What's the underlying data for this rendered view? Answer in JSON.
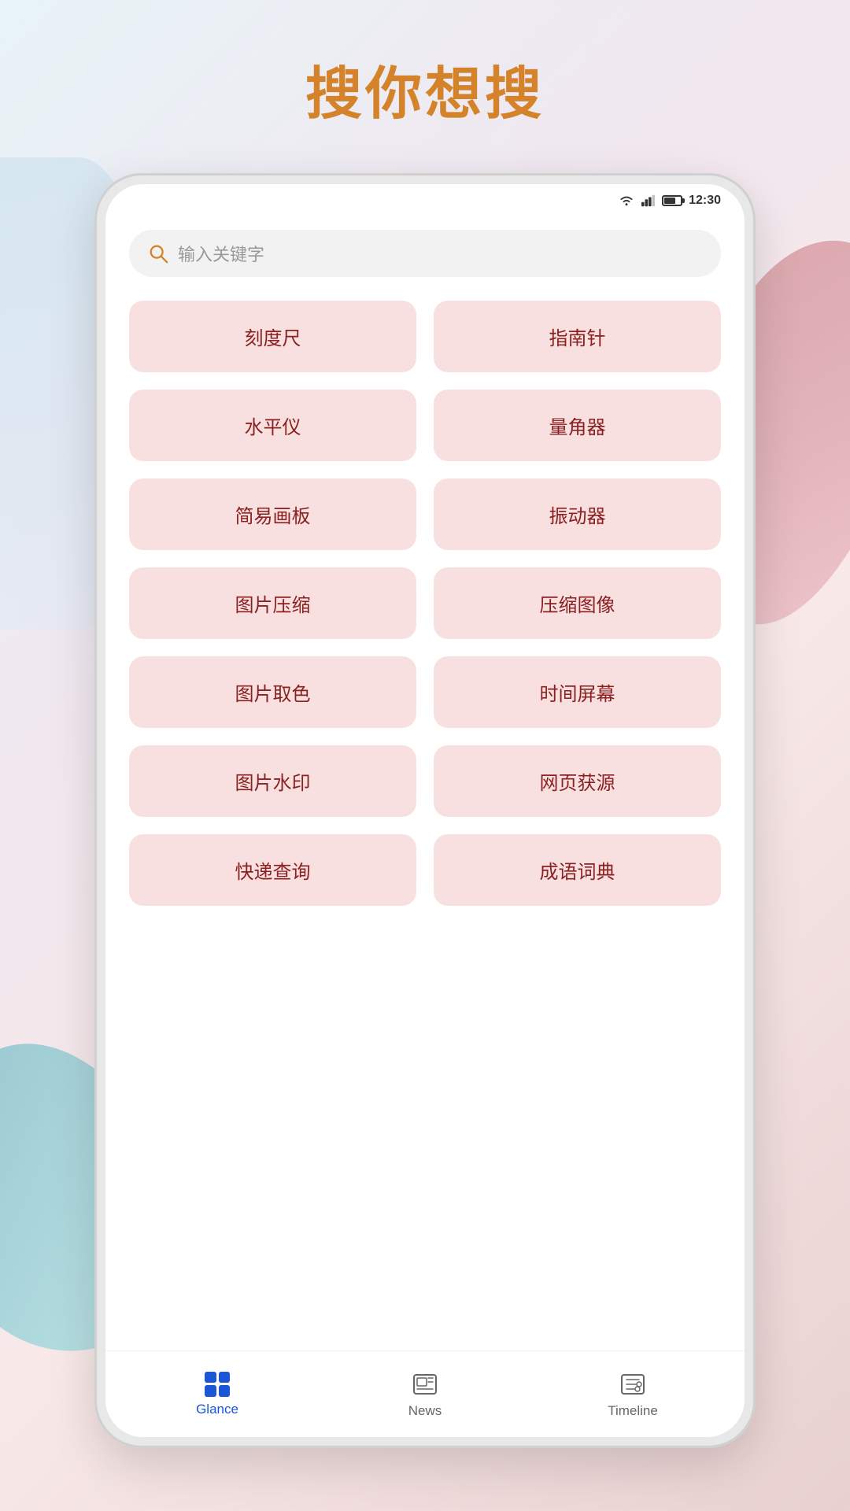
{
  "page": {
    "title": "搜你想搜",
    "background_colors": {
      "teal": "#6eb5c0",
      "pink": "#c97a80",
      "blue": "#b8d8e8"
    }
  },
  "status_bar": {
    "time": "12:30"
  },
  "search": {
    "placeholder": "输入关键字"
  },
  "tools": [
    {
      "id": "ruler",
      "label": "刻度尺"
    },
    {
      "id": "compass",
      "label": "指南针"
    },
    {
      "id": "level",
      "label": "水平仪"
    },
    {
      "id": "protractor",
      "label": "量角器"
    },
    {
      "id": "sketchpad",
      "label": "简易画板"
    },
    {
      "id": "vibrator",
      "label": "振动器"
    },
    {
      "id": "img-compress",
      "label": "图片压缩"
    },
    {
      "id": "img-compress2",
      "label": "压缩图像"
    },
    {
      "id": "color-picker",
      "label": "图片取色"
    },
    {
      "id": "time-screen",
      "label": "时间屏幕"
    },
    {
      "id": "watermark",
      "label": "图片水印"
    },
    {
      "id": "web-source",
      "label": "网页获源"
    },
    {
      "id": "courier",
      "label": "快递查询"
    },
    {
      "id": "idiom",
      "label": "成语词典"
    }
  ],
  "bottom_nav": {
    "items": [
      {
        "id": "glance",
        "label": "Glance",
        "active": true
      },
      {
        "id": "news",
        "label": "News",
        "active": false
      },
      {
        "id": "timeline",
        "label": "Timeline",
        "active": false
      }
    ]
  }
}
